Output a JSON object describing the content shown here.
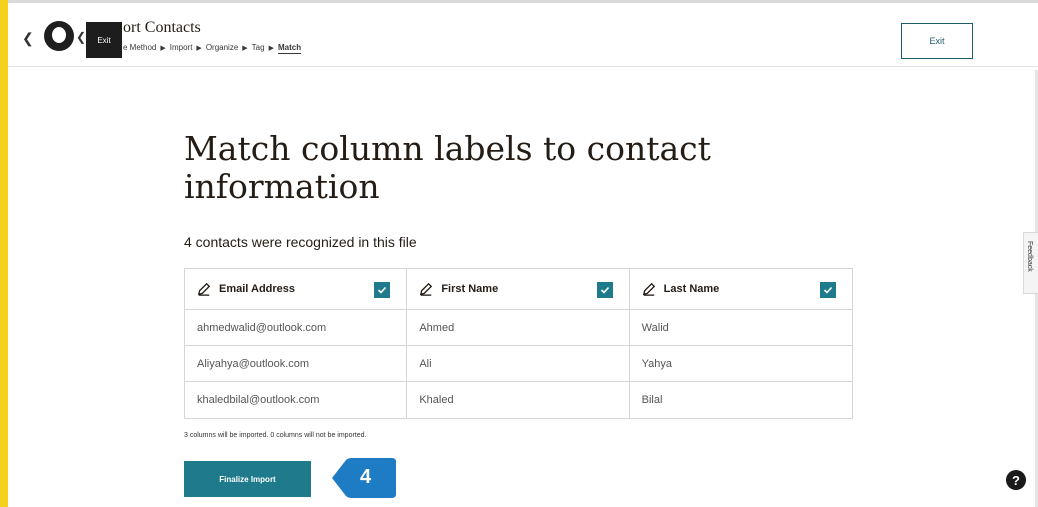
{
  "header": {
    "title": "ort Contacts",
    "tooltip": "Exit",
    "breadcrumb": [
      {
        "label": "e Method",
        "active": false
      },
      {
        "label": "Import",
        "active": false
      },
      {
        "label": "Organize",
        "active": false
      },
      {
        "label": "Tag",
        "active": false
      },
      {
        "label": "Match",
        "active": true
      }
    ],
    "exit_label": "Exit"
  },
  "feedback_label": "Feedback",
  "main": {
    "heading": "Match column labels to contact information",
    "subheading": "4 contacts were recognized in this file",
    "columns": [
      {
        "label": "Email Address",
        "checked": true
      },
      {
        "label": "First Name",
        "checked": true
      },
      {
        "label": "Last Name",
        "checked": true
      }
    ],
    "rows": [
      [
        "ahmedwalid@outlook.com",
        "Ahmed",
        "Walid"
      ],
      [
        "Aliyahya@outlook.com",
        "Ali",
        "Yahya"
      ],
      [
        "khaledbilal@outlook.com",
        "Khaled",
        "Bilal"
      ]
    ],
    "import_note": "3 columns will be imported. 0 columns will not be imported.",
    "finalize_label": "Finalize Import"
  },
  "step_badge": "4",
  "help_label": "?",
  "colors": {
    "accent": "#1f7a8c",
    "left_border": "#f2d21b",
    "step_badge": "#1e7cc4"
  },
  "icons": {
    "back": "chevron-left-icon",
    "logo": "freddie-logo-icon",
    "column_edit": "pencil-icon",
    "checkbox": "checkmark-icon",
    "help": "question-mark-icon"
  }
}
